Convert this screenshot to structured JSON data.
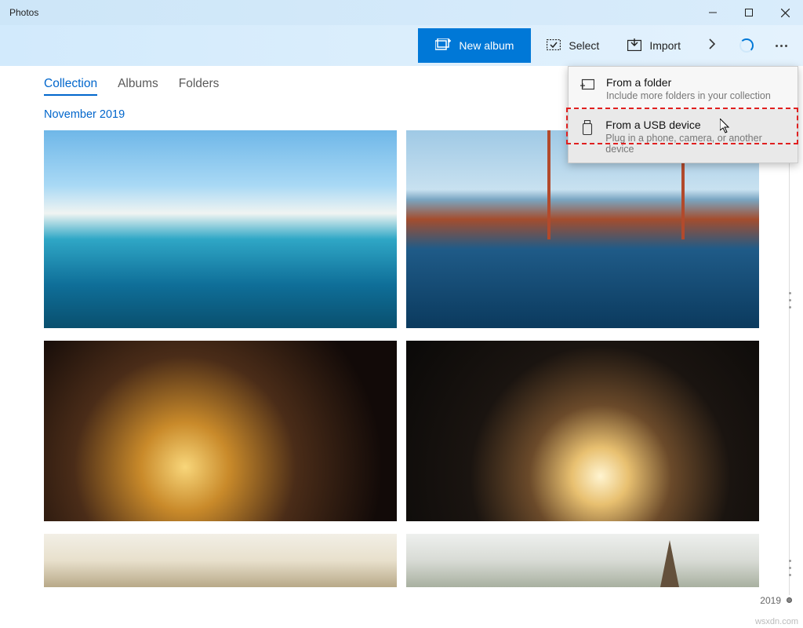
{
  "app": {
    "title": "Photos"
  },
  "toolbar": {
    "new_album": "New album",
    "select": "Select",
    "import": "Import"
  },
  "nav": {
    "collection": "Collection",
    "albums": "Albums",
    "folders": "Folders"
  },
  "content": {
    "date_group": "November 2019"
  },
  "dropdown": {
    "item1": {
      "title": "From a folder",
      "subtitle": "Include more folders in your collection"
    },
    "item2": {
      "title": "From a USB device",
      "subtitle": "Plug in a phone, camera, or another device"
    }
  },
  "timeline": {
    "year": "2019"
  },
  "watermark": "wsxdn.com"
}
